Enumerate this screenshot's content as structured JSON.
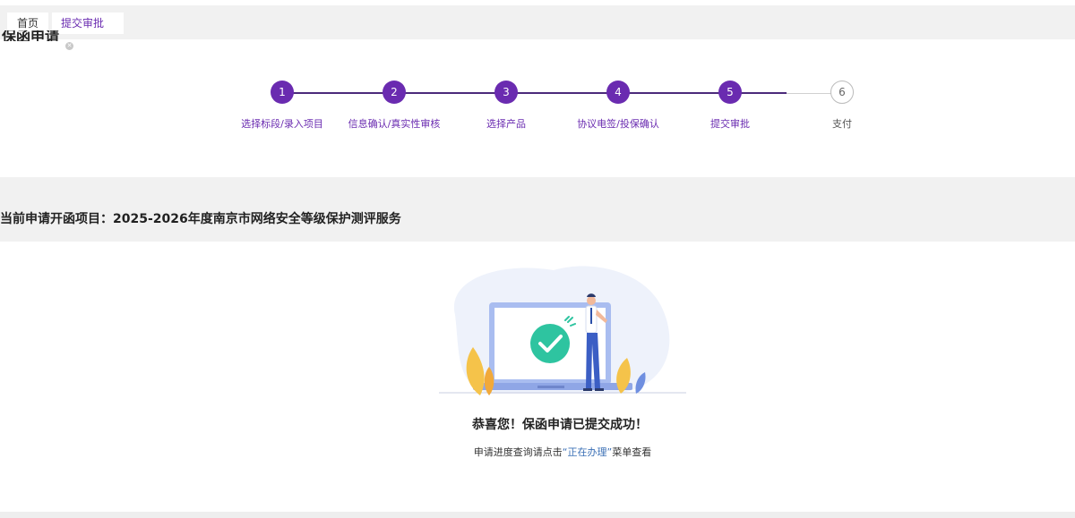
{
  "tabs": [
    {
      "label": "首页"
    },
    {
      "label": "提交审批",
      "close_icon": "close-icon"
    }
  ],
  "page_title": "保函申请",
  "steps": [
    {
      "number": "1",
      "label": "选择标段/录入项目",
      "state": "done"
    },
    {
      "number": "2",
      "label": "信息确认/真实性审核",
      "state": "done"
    },
    {
      "number": "3",
      "label": "选择产品",
      "state": "done"
    },
    {
      "number": "4",
      "label": "协议电签/投保确认",
      "state": "done"
    },
    {
      "number": "5",
      "label": "提交审批",
      "state": "done"
    },
    {
      "number": "6",
      "label": "支付",
      "state": "todo"
    }
  ],
  "project_line": "当前申请开函项目：2025-2026年度南京市网络安全等级保护测评服务",
  "success_title": "恭喜您！保函申请已提交成功！",
  "hint": {
    "prefix": "申请进度查询请点击",
    "link": "“正在办理”",
    "suffix": "菜单查看"
  },
  "colors": {
    "accent": "#6a2bb0",
    "check": "#2ec4a0",
    "link": "#3a6fb5"
  },
  "illustration": "laptop-success-illustration"
}
